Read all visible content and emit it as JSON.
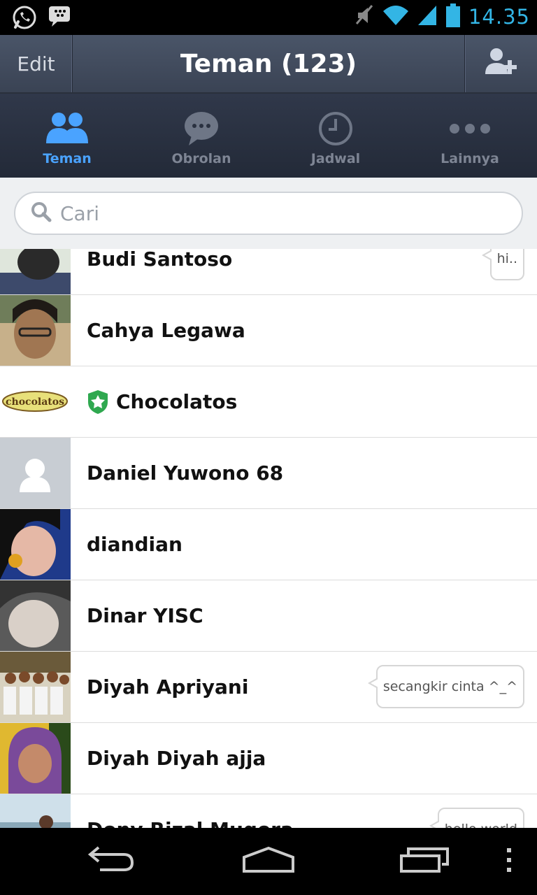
{
  "status_bar": {
    "time": "14.35",
    "left_icons": [
      "whatsapp-icon",
      "bbm-icon"
    ],
    "right_icons": [
      "muted-icon",
      "wifi-icon",
      "signal-icon",
      "battery-icon"
    ],
    "time_color": "#33b5e5"
  },
  "action_bar": {
    "edit_label": "Edit",
    "title": "Teman (123)",
    "add_friend_icon": "add-user-icon"
  },
  "tabs": [
    {
      "label": "Teman",
      "icon": "friends-icon",
      "active": true
    },
    {
      "label": "Obrolan",
      "icon": "chat-bubble-icon",
      "active": false
    },
    {
      "label": "Jadwal",
      "icon": "clock-icon",
      "active": false
    },
    {
      "label": "Lainnya",
      "icon": "more-dots-icon",
      "active": false
    }
  ],
  "search": {
    "placeholder": "Cari"
  },
  "contacts": [
    {
      "name": "Budi Santoso",
      "status": "hi.."
    },
    {
      "name": "Cahya Legawa",
      "status": ""
    },
    {
      "name": "Chocolatos",
      "status": "",
      "official_badge": true,
      "logo_text": "chocolatos"
    },
    {
      "name": "Daniel Yuwono 68",
      "status": ""
    },
    {
      "name": "diandian",
      "status": ""
    },
    {
      "name": "Dinar YISC",
      "status": ""
    },
    {
      "name": "Diyah Apriyani",
      "status": "secangkir cinta ^_^"
    },
    {
      "name": "Diyah Diyah ajja",
      "status": ""
    },
    {
      "name": "Dony Rizal Mugora",
      "status": "hello world"
    }
  ],
  "nav_bar": {
    "icons": [
      "back-icon",
      "home-icon",
      "recent-apps-icon",
      "menu-icon"
    ]
  },
  "colors": {
    "accent": "#4aa3ff",
    "tab_inactive": "#7e8594",
    "action_bar": "#3a4354"
  }
}
